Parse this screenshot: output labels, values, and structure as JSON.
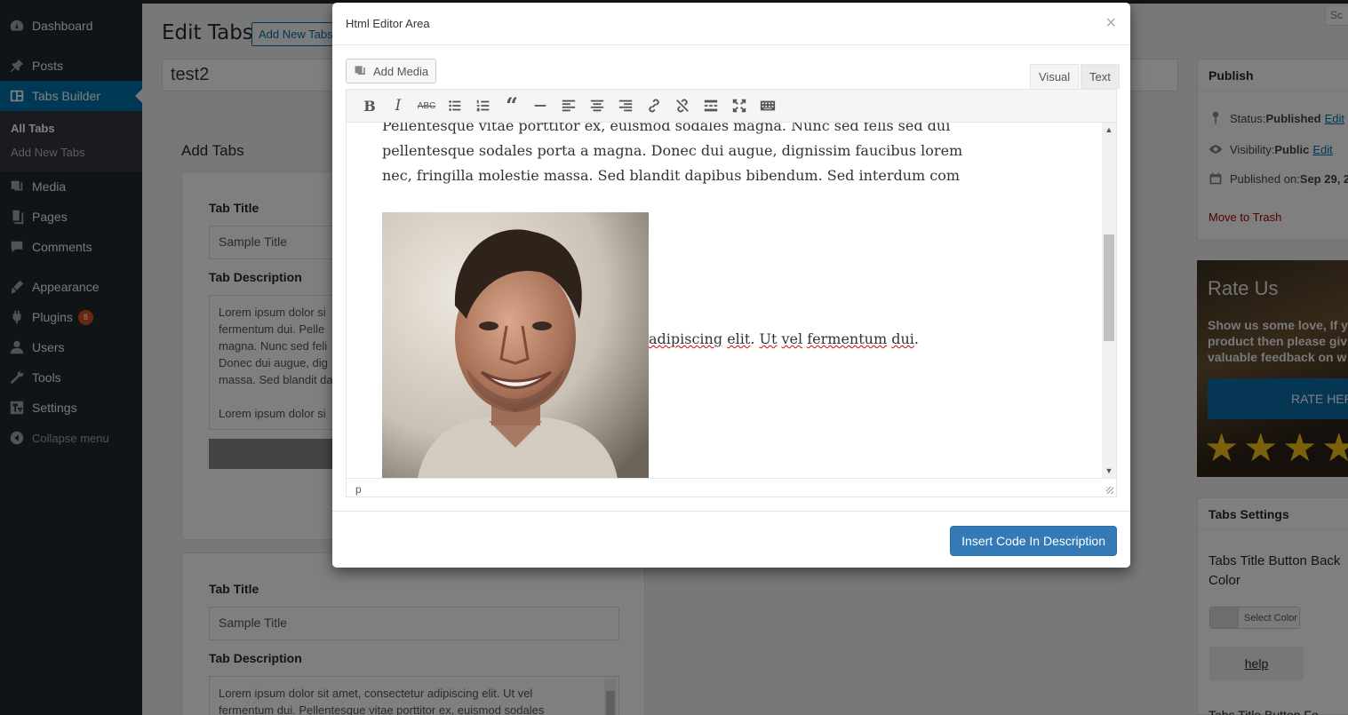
{
  "sidebar": {
    "items": [
      {
        "label": "Dashboard",
        "icon": "dashboard-icon"
      },
      {
        "label": "Posts",
        "icon": "pin-icon"
      },
      {
        "label": "Tabs Builder",
        "icon": "tabs-icon",
        "active": true
      },
      {
        "label": "Media",
        "icon": "media-icon"
      },
      {
        "label": "Pages",
        "icon": "pages-icon"
      },
      {
        "label": "Comments",
        "icon": "comments-icon"
      },
      {
        "label": "Appearance",
        "icon": "brush-icon"
      },
      {
        "label": "Plugins",
        "icon": "plugin-icon",
        "badge": "8"
      },
      {
        "label": "Users",
        "icon": "users-icon"
      },
      {
        "label": "Tools",
        "icon": "wrench-icon"
      },
      {
        "label": "Settings",
        "icon": "settings-icon"
      }
    ],
    "submenu": [
      "All Tabs",
      "Add New Tabs"
    ],
    "collapse_label": "Collapse menu"
  },
  "header": {
    "title": "Edit Tabs",
    "add_new_label": "Add New Tabs",
    "post_title": "test2",
    "screen_options": "Sc"
  },
  "tabs_section": {
    "heading": "Add Tabs",
    "card1": {
      "title_label": "Tab Title",
      "title_value": "Sample Title",
      "desc_label": "Tab Description",
      "desc_lines_a": [
        "Lorem ipsum dolor si",
        "fermentum dui. Pelle",
        "magna. Nunc sed feli",
        "Donec dui augue, dig",
        "massa. Sed blandit da"
      ],
      "desc_line_b": "Lorem ipsum dolor si"
    },
    "card2": {
      "title_label": "Tab Title",
      "title_value": "Sample Title",
      "desc_label": "Tab Description",
      "desc_lines": [
        "Lorem ipsum dolor sit amet, consectetur adipiscing elit. Ut vel",
        "fermentum dui. Pellentesque vitae porttitor ex, euismod sodales"
      ]
    }
  },
  "publish": {
    "title": "Publish",
    "status_label": "Status: ",
    "status_value": "Published",
    "visibility_label": "Visibility: ",
    "visibility_value": "Public",
    "published_label": "Published on: ",
    "published_value": "Sep 29, 2",
    "edit_label": "Edit",
    "trash_label": "Move to Trash"
  },
  "rate": {
    "title": "Rate Us",
    "text": "Show us some love, If y product then please giv valuable feedback on w",
    "button": "RATE HERE",
    "stars": 4
  },
  "tabs_settings": {
    "title": "Tabs Settings",
    "bg_label": "Tabs Title Button Back Color",
    "select_color": "Select Color",
    "help": "help",
    "next_label": "Tabs Title Button Fo"
  },
  "modal": {
    "title": "Html Editor Area",
    "close": "×",
    "add_media": "Add Media",
    "tab_visual": "Visual",
    "tab_text": "Text",
    "toolbar": [
      "bold-icon",
      "italic-icon",
      "strikethrough-icon",
      "bullet-list-icon",
      "numbered-list-icon",
      "blockquote-icon",
      "horizontal-rule-icon",
      "align-left-icon",
      "align-center-icon",
      "align-right-icon",
      "link-icon",
      "unlink-icon",
      "read-more-icon",
      "fullscreen-icon",
      "toolbar-toggle-icon"
    ],
    "content_lines": [
      "Pellentesque vitae porttitor ex, euismod sodales magna. Nunc sed felis sed dui",
      "pellentesque sodales porta a magna. Donec dui augue, dignissim faucibus lorem",
      "nec, fringilla molestie massa. Sed blandit dapibus bibendum. Sed interdum com"
    ],
    "caption_parts": [
      "adipiscing",
      " ",
      "elit",
      ". ",
      "Ut",
      " ",
      "vel",
      " ",
      "fermentum",
      " ",
      "dui",
      "."
    ],
    "status_path": "p",
    "insert_button": "Insert Code In Description"
  }
}
